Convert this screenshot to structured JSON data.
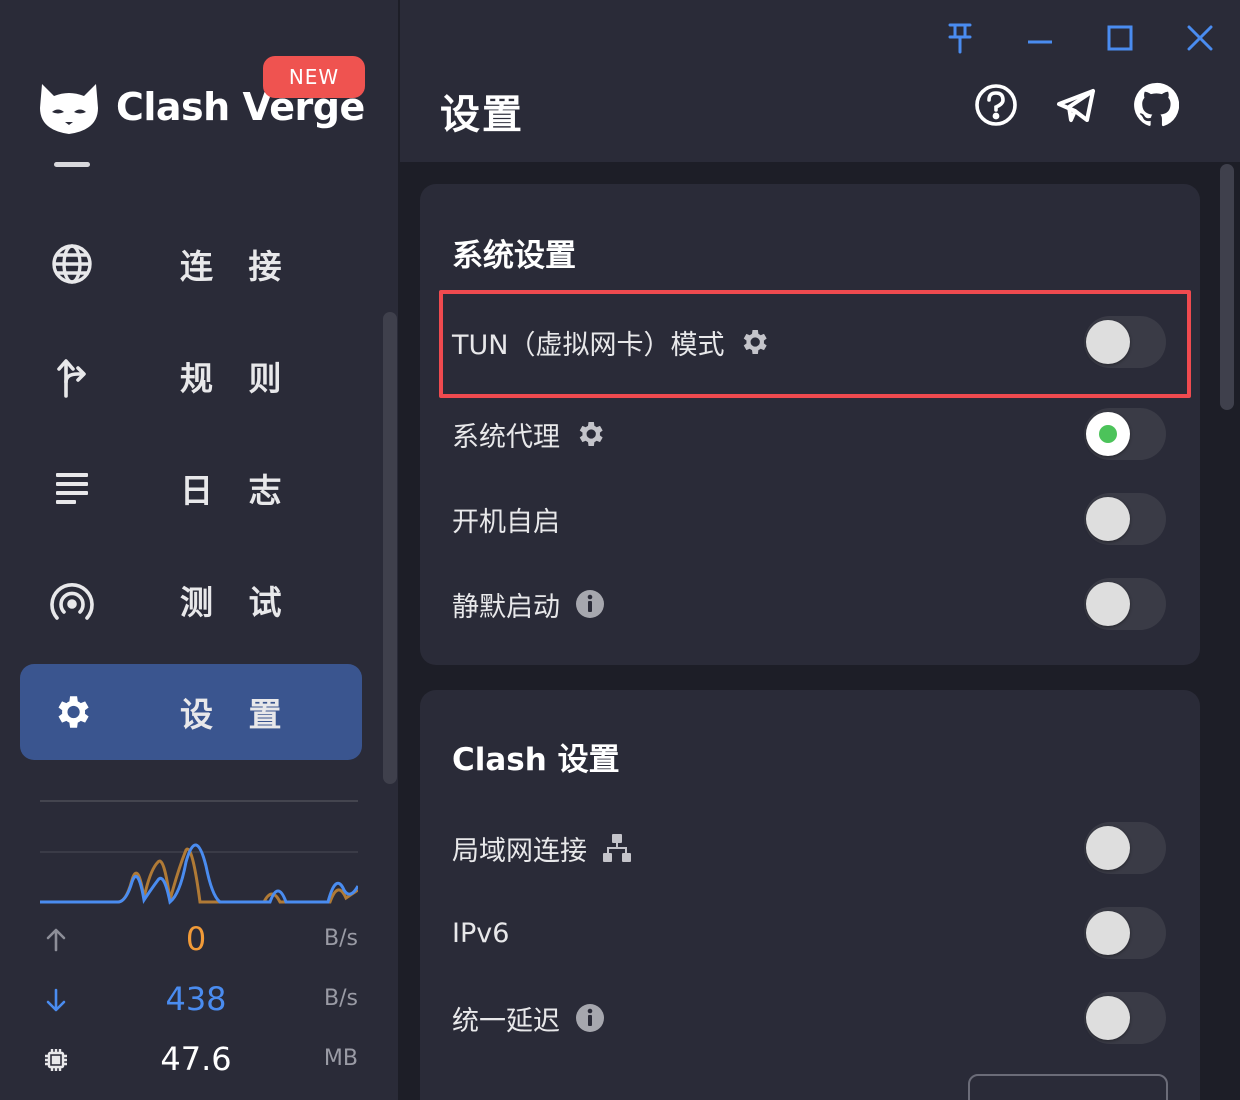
{
  "app": {
    "name": "Clash Verge",
    "badge": "NEW"
  },
  "sidebar": {
    "items": [
      {
        "label": "连 接",
        "icon": "globe-icon",
        "active": false
      },
      {
        "label": "规 则",
        "icon": "route-split-icon",
        "active": false
      },
      {
        "label": "日 志",
        "icon": "lines-icon",
        "active": false
      },
      {
        "label": "测 试",
        "icon": "broadcast-icon",
        "active": false
      },
      {
        "label": "设 置",
        "icon": "gear-icon",
        "active": true
      }
    ],
    "traffic": {
      "upload": {
        "value": "0",
        "unit": "B/s",
        "color": "#f29b38"
      },
      "download": {
        "value": "438",
        "unit": "B/s",
        "color": "#4a8cf0"
      },
      "memory": {
        "value": "47.6",
        "unit": "MB"
      }
    }
  },
  "header": {
    "title": "设置",
    "window_controls": [
      "pin-icon",
      "minimize-icon",
      "maximize-icon",
      "close-icon"
    ],
    "actions": [
      "help-icon",
      "telegram-icon",
      "github-icon"
    ]
  },
  "system_settings": {
    "title": "系统设置",
    "rows": [
      {
        "label": "TUN（虚拟网卡）模式",
        "extra": "gear-icon",
        "on": false,
        "highlighted": true
      },
      {
        "label": "系统代理",
        "extra": "gear-icon",
        "on": true
      },
      {
        "label": "开机自启",
        "extra": "",
        "on": false
      },
      {
        "label": "静默启动",
        "extra": "info-icon",
        "on": false
      }
    ]
  },
  "clash_settings": {
    "title": "Clash 设置",
    "rows": [
      {
        "label": "局域网连接",
        "extra": "network-icon",
        "on": false
      },
      {
        "label": "IPv6",
        "extra": "",
        "on": false
      },
      {
        "label": "统一延迟",
        "extra": "info-icon",
        "on": false
      }
    ]
  },
  "colors": {
    "accent": "#3a558f",
    "highlight": "#ef4a4f",
    "badge": "#ef5350",
    "on": "#4cc35a"
  }
}
